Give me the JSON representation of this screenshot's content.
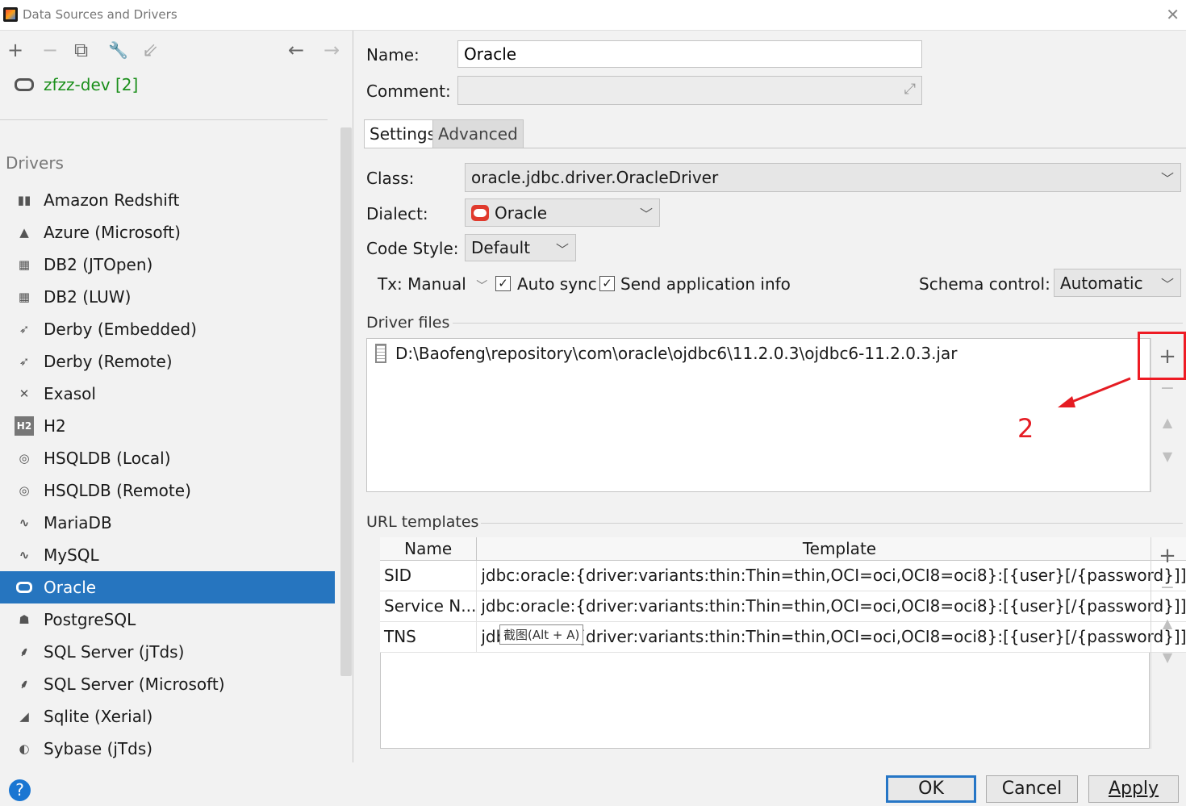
{
  "window": {
    "title": "Data Sources and Drivers"
  },
  "toolbar": {
    "add": "+",
    "remove": "−",
    "copy": "⧉",
    "settings": "🔧",
    "import": "⇙",
    "back": "←",
    "forward": "→"
  },
  "data_sources": [
    {
      "label": "zfzz-dev [2]"
    }
  ],
  "drivers": {
    "heading": "Drivers",
    "items": [
      {
        "label": "Amazon Redshift",
        "icon": "▮▮"
      },
      {
        "label": "Azure (Microsoft)",
        "icon": "▲"
      },
      {
        "label": "DB2 (JTOpen)",
        "icon": "▦"
      },
      {
        "label": "DB2 (LUW)",
        "icon": "▦"
      },
      {
        "label": "Derby (Embedded)",
        "icon": "➶"
      },
      {
        "label": "Derby (Remote)",
        "icon": "➶"
      },
      {
        "label": "Exasol",
        "icon": "✕"
      },
      {
        "label": "H2",
        "icon": "H2"
      },
      {
        "label": "HSQLDB (Local)",
        "icon": "◎"
      },
      {
        "label": "HSQLDB (Remote)",
        "icon": "◎"
      },
      {
        "label": "MariaDB",
        "icon": "∿"
      },
      {
        "label": "MySQL",
        "icon": "∿"
      },
      {
        "label": "Oracle",
        "icon": "⬭"
      },
      {
        "label": "PostgreSQL",
        "icon": "☗"
      },
      {
        "label": "SQL Server (jTds)",
        "icon": "⸙"
      },
      {
        "label": "SQL Server (Microsoft)",
        "icon": "⸙"
      },
      {
        "label": "Sqlite (Xerial)",
        "icon": "◢"
      },
      {
        "label": "Sybase (jTds)",
        "icon": "◐"
      }
    ],
    "selected": "Oracle"
  },
  "form": {
    "name_label": "Name:",
    "name_value": "Oracle",
    "comment_label": "Comment:",
    "comment_value": "",
    "tabs": [
      "Settings",
      "Advanced"
    ],
    "class_label": "Class:",
    "class_value": "oracle.jdbc.driver.OracleDriver",
    "dialect_label": "Dialect:",
    "dialect_value": "Oracle",
    "codestyle_label": "Code Style:",
    "codestyle_value": "Default",
    "tx_label": "Tx: Manual",
    "autosync_label": "Auto sync",
    "sendinfo_label": "Send application info",
    "schema_label": "Schema control:",
    "schema_value": "Automatic"
  },
  "driver_files": {
    "title": "Driver files",
    "files": [
      "D:\\Baofeng\\repository\\com\\oracle\\ojdbc6\\11.2.0.3\\ojdbc6-11.2.0.3.jar"
    ]
  },
  "annotation": {
    "label": "2",
    "color": "#e51c23"
  },
  "url_templates": {
    "title": "URL templates",
    "columns": [
      "Name",
      "Template"
    ],
    "rows": [
      {
        "name": "SID",
        "template": "jdbc:oracle:{driver:variants:thin:Thin=thin,OCI=oci,OCI8=oci8}:[{user}[/{password}]]..."
      },
      {
        "name": "Service N...",
        "template": "jdbc:oracle:{driver:variants:thin:Thin=thin,OCI=oci,OCI8=oci8}:[{user}[/{password}]]..."
      },
      {
        "name": "TNS",
        "template": "jdbc:oracle:{driver:variants:thin:Thin=thin,OCI=oci,OCI8=oci8}:[{user}[/{password}]]..."
      }
    ]
  },
  "tooltip": "截图(Alt + A)",
  "buttons": {
    "help": "?",
    "ok": "OK",
    "cancel": "Cancel",
    "apply": "Apply"
  }
}
